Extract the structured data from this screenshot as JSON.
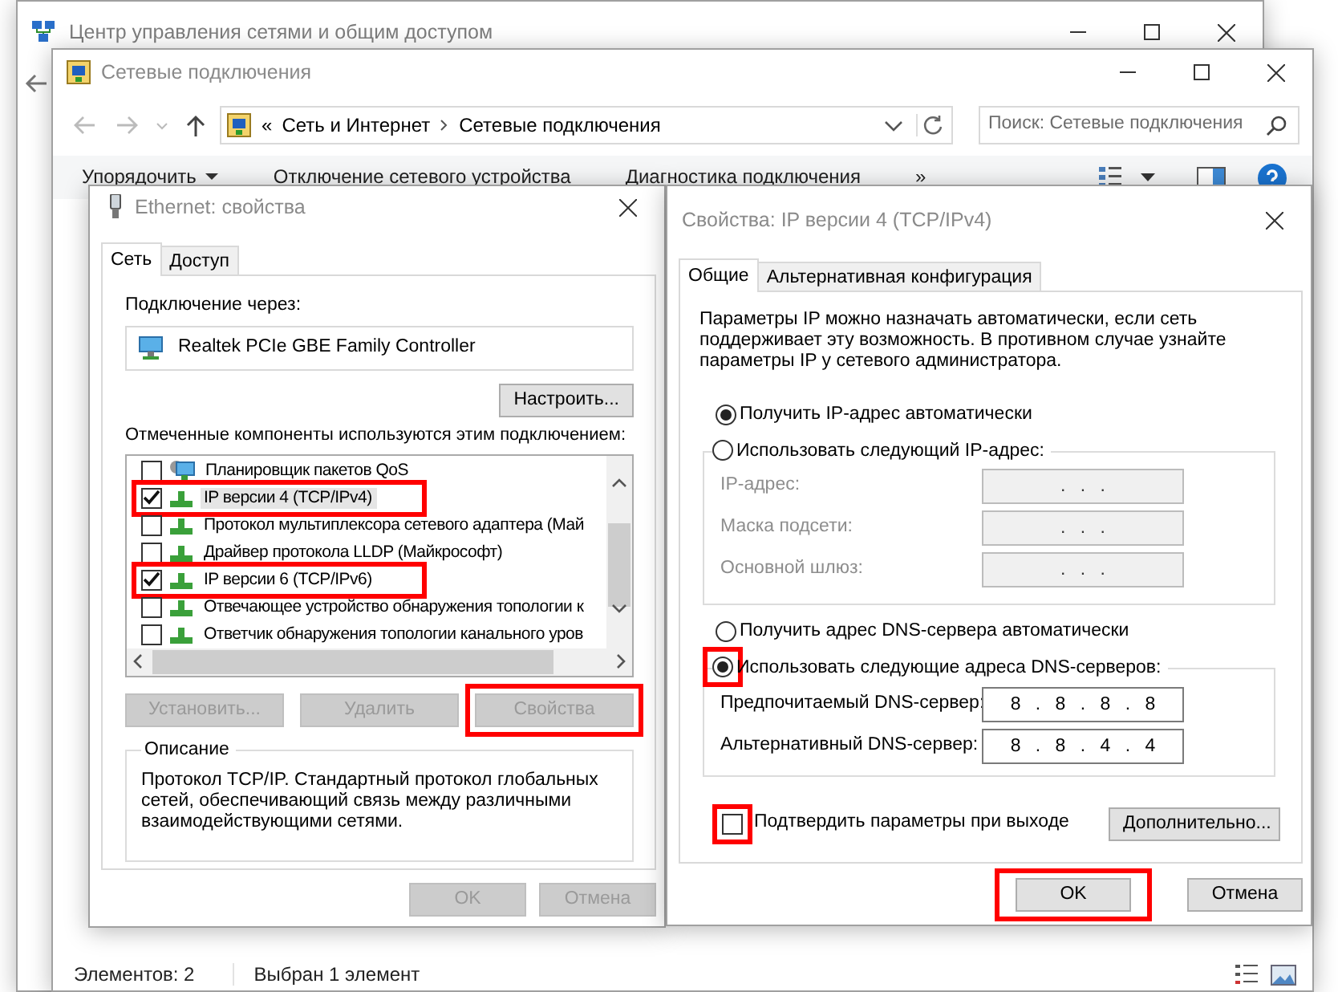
{
  "back_window": {
    "title": "Центр управления сетями и общим доступом"
  },
  "explorer": {
    "title": "Сетевые подключения",
    "breadcrumb_prefix": "«",
    "breadcrumb": [
      "Сеть и Интернет",
      "Сетевые подключения"
    ],
    "search": {
      "placeholder": "Поиск: Сетевые подключения"
    },
    "toolbar": [
      {
        "label": "Упорядочить",
        "dropdown": true
      },
      {
        "label": "Отключение сетевого устройства",
        "dropdown": false
      },
      {
        "label": "Диагностика подключения",
        "dropdown": false
      },
      {
        "label": "»",
        "dropdown": false
      }
    ],
    "status_bar": [
      "Элементов: 2",
      "Выбран 1 элемент"
    ]
  },
  "ethernet_dialog": {
    "title": "Ethernet: свойства",
    "tabs": [
      {
        "label": "Сеть",
        "selected": true
      },
      {
        "label": "Доступ",
        "selected": false
      }
    ],
    "connect_label": "Подключение через:",
    "adapter": "Realtek PCIe GBE Family Controller",
    "configure_button": "Настроить...",
    "components_label": "Отмеченные компоненты используются этим подключением:",
    "components": [
      {
        "label": "Планировщик пакетов QoS",
        "kind": "service",
        "checked": false,
        "selected": false,
        "highlighted": false
      },
      {
        "label": "IP версии 4 (TCP/IPv4)",
        "kind": "protocol",
        "checked": true,
        "selected": true,
        "highlighted": true
      },
      {
        "label": "Протокол мультиплексора сетевого адаптера (Май",
        "kind": "protocol",
        "checked": false,
        "selected": false,
        "highlighted": false
      },
      {
        "label": "Драйвер протокола LLDP (Майкрософт)",
        "kind": "protocol",
        "checked": false,
        "selected": false,
        "highlighted": false
      },
      {
        "label": "IP версии 6 (TCP/IPv6)",
        "kind": "protocol",
        "checked": true,
        "selected": false,
        "highlighted": true
      },
      {
        "label": "Отвечающее устройство обнаружения топологии к",
        "kind": "protocol",
        "checked": false,
        "selected": false,
        "highlighted": false
      },
      {
        "label": "Ответчик обнаружения топологии канального уров",
        "kind": "protocol",
        "checked": false,
        "selected": false,
        "highlighted": false
      }
    ],
    "buttons": [
      {
        "label": "Установить...",
        "disabled": true,
        "highlighted": false
      },
      {
        "label": "Удалить",
        "disabled": true,
        "highlighted": false
      },
      {
        "label": "Свойства",
        "disabled": true,
        "highlighted": true
      }
    ],
    "description": {
      "legend": "Описание",
      "text": "Протокол TCP/IP. Стандартный протокол глобальных сетей, обеспечивающий связь между различными взаимодействующими сетями."
    },
    "footer_buttons": [
      {
        "label": "OK",
        "disabled": true,
        "highlighted": false
      },
      {
        "label": "Отмена",
        "disabled": true,
        "highlighted": false
      }
    ]
  },
  "ipv4_dialog": {
    "title": "Свойства: IP версии 4 (TCP/IPv4)",
    "tabs": [
      {
        "label": "Общие",
        "selected": true
      },
      {
        "label": "Альтернативная конфигурация",
        "selected": false
      }
    ],
    "intro": "Параметры IP можно назначать автоматически, если сеть поддерживает эту возможность. В противном случае узнайте параметры IP у сетевого администратора.",
    "ip_mode": [
      {
        "label": "Получить IP-адрес автоматически",
        "selected": true,
        "highlighted": false
      },
      {
        "label": "Использовать следующий IP-адрес:",
        "selected": false,
        "highlighted": false
      }
    ],
    "ip_fields": [
      {
        "label": "IP-адрес:",
        "value": ". . .",
        "disabled": true
      },
      {
        "label": "Маска подсети:",
        "value": ". . .",
        "disabled": true
      },
      {
        "label": "Основной шлюз:",
        "value": ". . .",
        "disabled": true
      }
    ],
    "dns_mode": [
      {
        "label": "Получить адрес DNS-сервера автоматически",
        "selected": false,
        "highlighted": false
      },
      {
        "label": "Использовать следующие адреса DNS-серверов:",
        "selected": true,
        "highlighted": true
      }
    ],
    "dns_fields": [
      {
        "label": "Предпочитаемый DNS-сервер:",
        "value": "8 . 8 . 8 . 8",
        "disabled": false
      },
      {
        "label": "Альтернативный DNS-сервер:",
        "value": "8 . 8 . 4 . 4",
        "disabled": false
      }
    ],
    "validate": {
      "label": "Подтвердить параметры при выходе",
      "checked": false,
      "highlighted": true
    },
    "advanced_button": "Дополнительно...",
    "footer_buttons": [
      {
        "label": "OK",
        "disabled": false,
        "highlighted": true
      },
      {
        "label": "Отмена",
        "disabled": false,
        "highlighted": false
      }
    ]
  }
}
